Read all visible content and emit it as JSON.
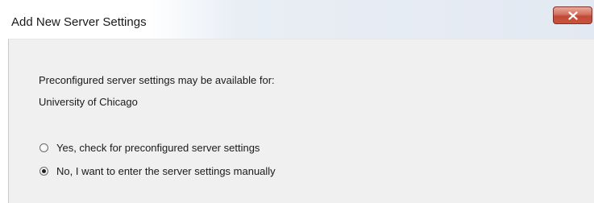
{
  "window": {
    "title": "Add New Server Settings"
  },
  "icons": {
    "close": "close-icon"
  },
  "content": {
    "prompt": "Preconfigured server settings may be available for:",
    "organization": "University of Chicago",
    "options": [
      {
        "label": "Yes, check for preconfigured server settings",
        "selected": false
      },
      {
        "label": "No, I want to enter the server settings manually",
        "selected": true
      }
    ]
  },
  "colors": {
    "close_button": "#c8533d",
    "content_background": "#f0f0f0"
  }
}
